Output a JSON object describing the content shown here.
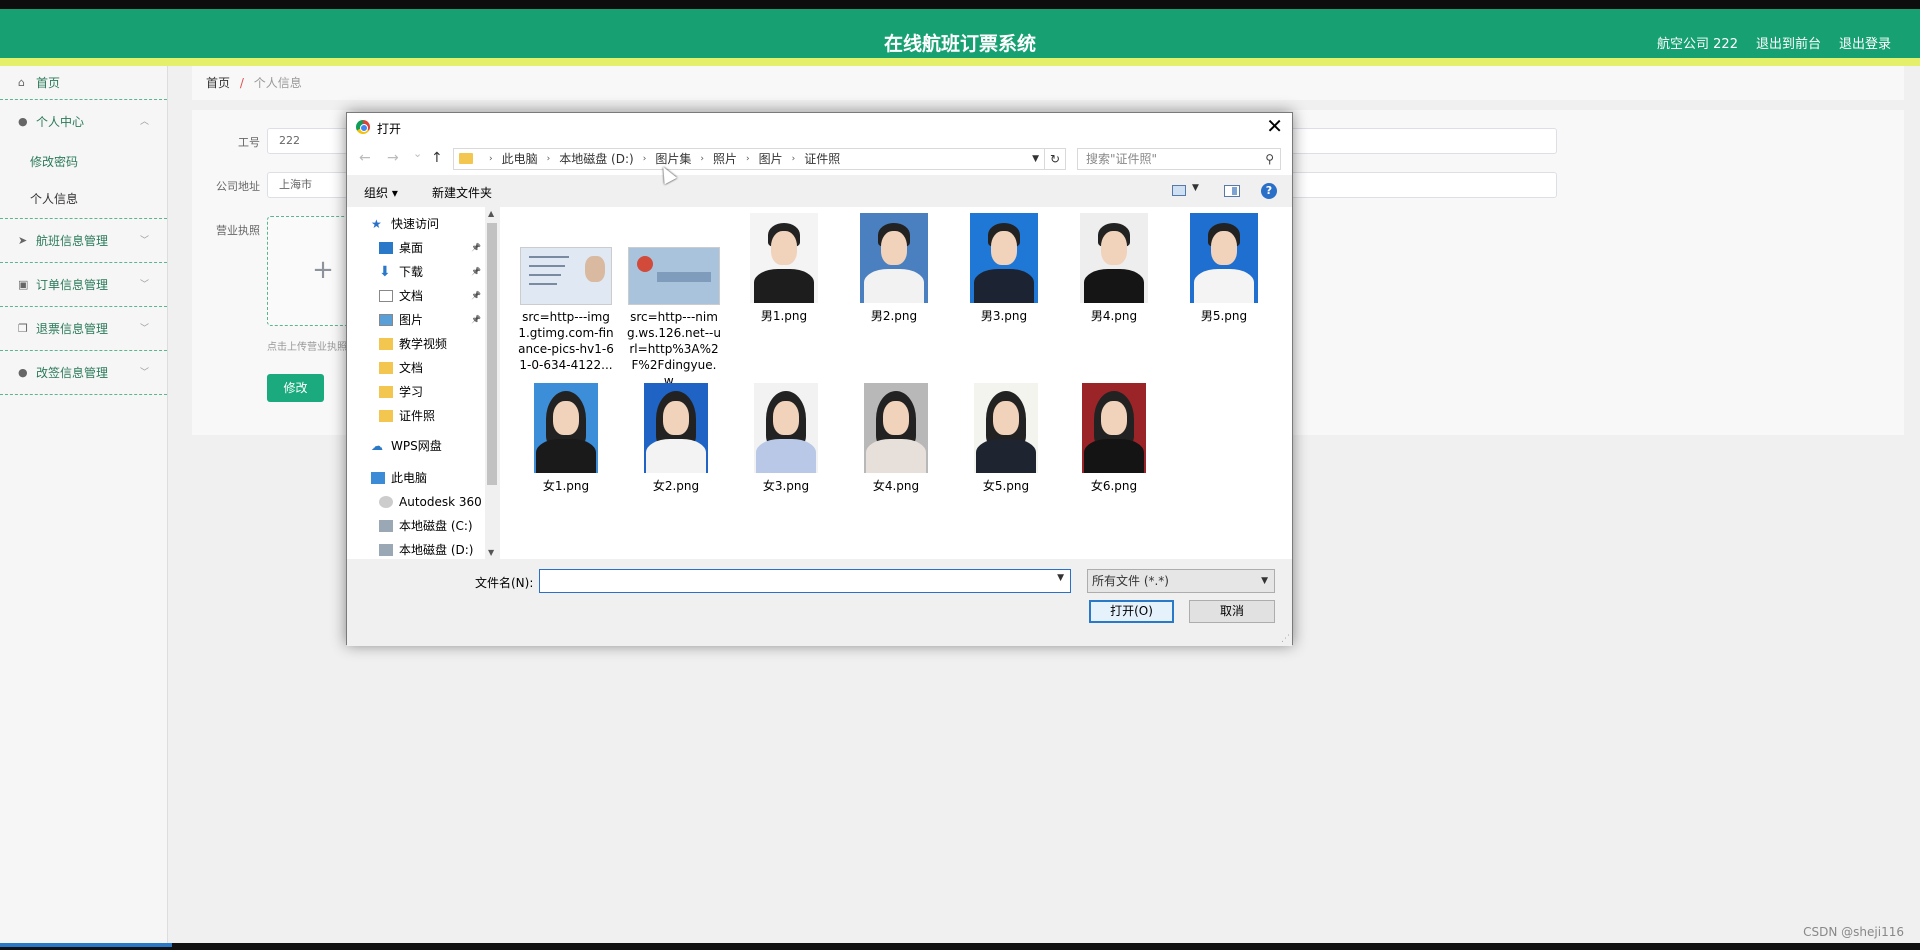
{
  "app": {
    "title": "在线航班订票系统",
    "company": "航空公司 222",
    "to_front": "退出到前台",
    "logout": "退出登录"
  },
  "sidebar": {
    "items": [
      {
        "label": "首页",
        "icon": "home-icon"
      },
      {
        "label": "个人中心",
        "icon": "user-icon",
        "expanded": true,
        "children": [
          {
            "label": "修改密码"
          },
          {
            "label": "个人信息",
            "active": true
          }
        ]
      },
      {
        "label": "航班信息管理",
        "icon": "plane-icon"
      },
      {
        "label": "订单信息管理",
        "icon": "briefcase-icon"
      },
      {
        "label": "退票信息管理",
        "icon": "copy-icon"
      },
      {
        "label": "改签信息管理",
        "icon": "user-icon"
      }
    ]
  },
  "breadcrumb": {
    "home": "首页",
    "sep": "/",
    "current": "个人信息"
  },
  "form": {
    "id_label": "工号",
    "id_value": "222",
    "address_label": "公司地址",
    "address_value": "上海市",
    "license_label": "营业执照",
    "upload_plus": "+",
    "upload_tip": "点击上传营业执照",
    "submit": "修改"
  },
  "dialog": {
    "title": "打开",
    "close": "✕",
    "nav": {
      "back": "←",
      "forward": "→",
      "recent": "⌄",
      "up": "↑"
    },
    "path": [
      "此电脑",
      "本地磁盘 (D:)",
      "图片集",
      "照片",
      "图片",
      "证件照"
    ],
    "search_placeholder": "搜索\"证件照\"",
    "toolbar": {
      "organize": "组织 ▾",
      "new_folder": "新建文件夹",
      "help": "?"
    },
    "nav_tree": [
      {
        "label": "快速访问",
        "icon": "star-icon",
        "indent": 1
      },
      {
        "label": "桌面",
        "icon": "desktop-icon",
        "indent": 2,
        "pinned": true
      },
      {
        "label": "下载",
        "icon": "download-icon",
        "indent": 2,
        "pinned": true
      },
      {
        "label": "文档",
        "icon": "document-icon",
        "indent": 2,
        "pinned": true
      },
      {
        "label": "图片",
        "icon": "pictures-icon",
        "indent": 2,
        "pinned": true
      },
      {
        "label": "教学视频",
        "icon": "folder-icon",
        "indent": 2
      },
      {
        "label": "文档",
        "icon": "folder-icon",
        "indent": 2
      },
      {
        "label": "学习",
        "icon": "folder-icon",
        "indent": 2
      },
      {
        "label": "证件照",
        "icon": "folder-icon",
        "indent": 2
      },
      {
        "label": "WPS网盘",
        "icon": "cloud-icon",
        "indent": 1
      },
      {
        "label": "此电脑",
        "icon": "computer-icon",
        "indent": 1
      },
      {
        "label": "Autodesk 360",
        "icon": "autodesk-icon",
        "indent": 2
      },
      {
        "label": "本地磁盘 (C:)",
        "icon": "drive-icon",
        "indent": 2
      },
      {
        "label": "本地磁盘 (D:)",
        "icon": "drive-icon",
        "indent": 2
      }
    ],
    "files": [
      {
        "name": "src=http---img1.gtimg.com-finance-pics-hv1-61-0-634-4122...",
        "kind": "idcard-back",
        "bg": "#dfe8f3"
      },
      {
        "name": "src=http---nimg.ws.126.net--url=http%3A%2F%2Fdingyue.w...",
        "kind": "idcard-front",
        "bg": "#aac3dd"
      },
      {
        "name": "男1.png",
        "kind": "male",
        "bg": "#f4f4f4",
        "suit": "#1d1d1d"
      },
      {
        "name": "男2.png",
        "kind": "male",
        "bg": "#4a7fc0",
        "suit": "#f2f2f2"
      },
      {
        "name": "男3.png",
        "kind": "male",
        "bg": "#1f78d6",
        "suit": "#1c2434"
      },
      {
        "name": "男4.png",
        "kind": "male",
        "bg": "#eeeeee",
        "suit": "#151515"
      },
      {
        "name": "男5.png",
        "kind": "male",
        "bg": "#1f6fd0",
        "suit": "#f4f4f4"
      },
      {
        "name": "女1.png",
        "kind": "female",
        "bg": "#3d8ed8",
        "suit": "#1a1a1a"
      },
      {
        "name": "女2.png",
        "kind": "female",
        "bg": "#1f63c5",
        "suit": "#f3f3f3"
      },
      {
        "name": "女3.png",
        "kind": "female",
        "bg": "#f2f2f2",
        "suit": "#b8c8e6"
      },
      {
        "name": "女4.png",
        "kind": "female",
        "bg": "#b8b8b8",
        "suit": "#e7e0da"
      },
      {
        "name": "女5.png",
        "kind": "female",
        "bg": "#f4f4ee",
        "suit": "#1e2430"
      },
      {
        "name": "女6.png",
        "kind": "female",
        "bg": "#9a2428",
        "suit": "#141414"
      }
    ],
    "filename_label": "文件名(N):",
    "filename_value": "",
    "filetype": "所有文件 (*.*)",
    "open_btn": "打开(O)",
    "cancel_btn": "取消"
  },
  "watermark": "CSDN @sheji116"
}
